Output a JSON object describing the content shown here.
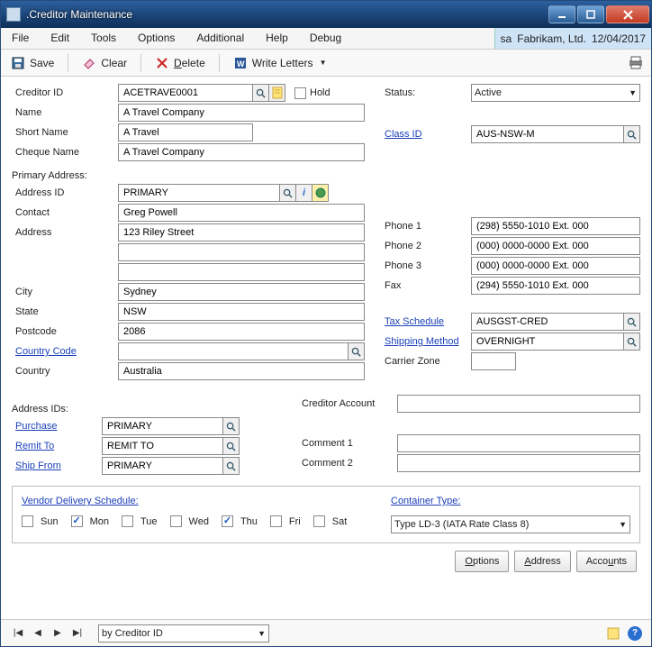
{
  "window": {
    "title": ".Creditor Maintenance"
  },
  "menubar": {
    "items": [
      "File",
      "Edit",
      "Tools",
      "Options",
      "Additional",
      "Help",
      "Debug"
    ],
    "user": "sa",
    "company": "Fabrikam, Ltd.",
    "date": "12/04/2017"
  },
  "toolbar": {
    "save": "Save",
    "clear": "Clear",
    "delete": "Delete",
    "write_letters": "Write Letters"
  },
  "creditor": {
    "id_label": "Creditor ID",
    "id": "ACETRAVE0001",
    "hold_label": "Hold",
    "name_label": "Name",
    "name": "A Travel Company",
    "short_name_label": "Short Name",
    "short_name": "A Travel",
    "cheque_name_label": "Cheque Name",
    "cheque_name": "A Travel Company",
    "status_label": "Status:",
    "status": "Active",
    "class_id_label": "Class ID",
    "class_id": "AUS-NSW-M"
  },
  "address": {
    "section_label": "Primary Address:",
    "id_label": "Address ID",
    "id": "PRIMARY",
    "contact_label": "Contact",
    "contact": "Greg Powell",
    "address_label": "Address",
    "line1": "123 Riley Street",
    "line2": "",
    "line3": "",
    "city_label": "City",
    "city": "Sydney",
    "state_label": "State",
    "state": "NSW",
    "postcode_label": "Postcode",
    "postcode": "2086",
    "country_code_label": "Country Code",
    "country_code": "",
    "country_label": "Country",
    "country": "Australia"
  },
  "phones": {
    "phone1_label": "Phone 1",
    "phone1": "(298) 5550-1010 Ext. 000",
    "phone2_label": "Phone 2",
    "phone2": "(000) 0000-0000 Ext. 000",
    "phone3_label": "Phone 3",
    "phone3": "(000) 0000-0000 Ext. 000",
    "fax_label": "Fax",
    "fax": "(294) 5550-1010 Ext. 000"
  },
  "misc": {
    "tax_schedule_label": "Tax Schedule",
    "tax_schedule": "AUSGST-CRED",
    "shipping_method_label": "Shipping Method",
    "shipping_method": "OVERNIGHT",
    "carrier_zone_label": "Carrier Zone",
    "carrier_zone": ""
  },
  "address_ids": {
    "section_label": "Address IDs:",
    "purchase_label": "Purchase",
    "purchase": "PRIMARY",
    "remit_to_label": "Remit To",
    "remit_to": "REMIT TO",
    "ship_from_label": "Ship From",
    "ship_from": "PRIMARY"
  },
  "account": {
    "creditor_account_label": "Creditor Account",
    "creditor_account": "",
    "comment1_label": "Comment 1",
    "comment1": "",
    "comment2_label": "Comment 2",
    "comment2": ""
  },
  "delivery": {
    "section_label": "Vendor Delivery Schedule:",
    "days": [
      {
        "label": "Sun",
        "checked": false
      },
      {
        "label": "Mon",
        "checked": true
      },
      {
        "label": "Tue",
        "checked": false
      },
      {
        "label": "Wed",
        "checked": false
      },
      {
        "label": "Thu",
        "checked": true
      },
      {
        "label": "Fri",
        "checked": false
      },
      {
        "label": "Sat",
        "checked": false
      }
    ],
    "container_label": "Container Type:",
    "container": "Type LD-3 (IATA Rate Class 8)"
  },
  "buttons": {
    "options": "Options",
    "address": "Address",
    "accounts": "Accounts"
  },
  "footer": {
    "sort_by": "by Creditor ID"
  }
}
